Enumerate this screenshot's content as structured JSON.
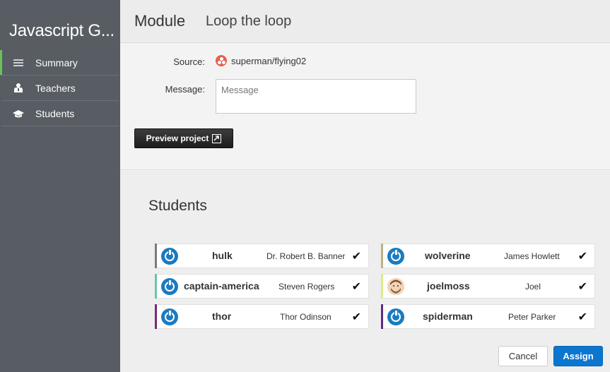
{
  "sidebar": {
    "title": "Javascript G...",
    "items": [
      {
        "label": "Summary",
        "icon": "list-icon",
        "active": true
      },
      {
        "label": "Teachers",
        "icon": "teacher-icon",
        "active": false
      },
      {
        "label": "Students",
        "icon": "graduation-cap-icon",
        "active": false
      }
    ]
  },
  "header": {
    "section": "Module",
    "name": "Loop the loop"
  },
  "form": {
    "source_label": "Source:",
    "source_value": "superman/flying02",
    "source_icon": "repository-icon",
    "message_label": "Message:",
    "message_placeholder": "Message",
    "message_value": "",
    "preview_button": "Preview project"
  },
  "students": {
    "title": "Students",
    "left_column": [
      {
        "login": "hulk",
        "name": "Dr. Robert B. Banner",
        "accent": "#7a7a7a",
        "avatar": "power-icon",
        "checked": true
      },
      {
        "login": "captain-america",
        "name": "Steven Rogers",
        "accent": "#6cc5a2",
        "avatar": "power-icon",
        "checked": true
      },
      {
        "login": "thor",
        "name": "Thor Odinson",
        "accent": "#7b2a74",
        "avatar": "power-icon",
        "checked": true
      }
    ],
    "right_column": [
      {
        "login": "wolverine",
        "name": "James Howlett",
        "accent": "#bfb08a",
        "avatar": "power-icon",
        "checked": true
      },
      {
        "login": "joelmoss",
        "name": "Joel",
        "accent": "#d8ec8a",
        "avatar": "user-face-icon",
        "checked": true
      },
      {
        "login": "spiderman",
        "name": "Peter Parker",
        "accent": "#5a2d83",
        "avatar": "power-icon",
        "checked": true
      }
    ],
    "check_glyph": "✔"
  },
  "actions": {
    "cancel": "Cancel",
    "assign": "Assign"
  },
  "colors": {
    "sidebar_bg": "#575d63",
    "active_indicator": "#6ac259",
    "primary": "#0b76d0",
    "avatar_blue": "#1a7bc1"
  }
}
